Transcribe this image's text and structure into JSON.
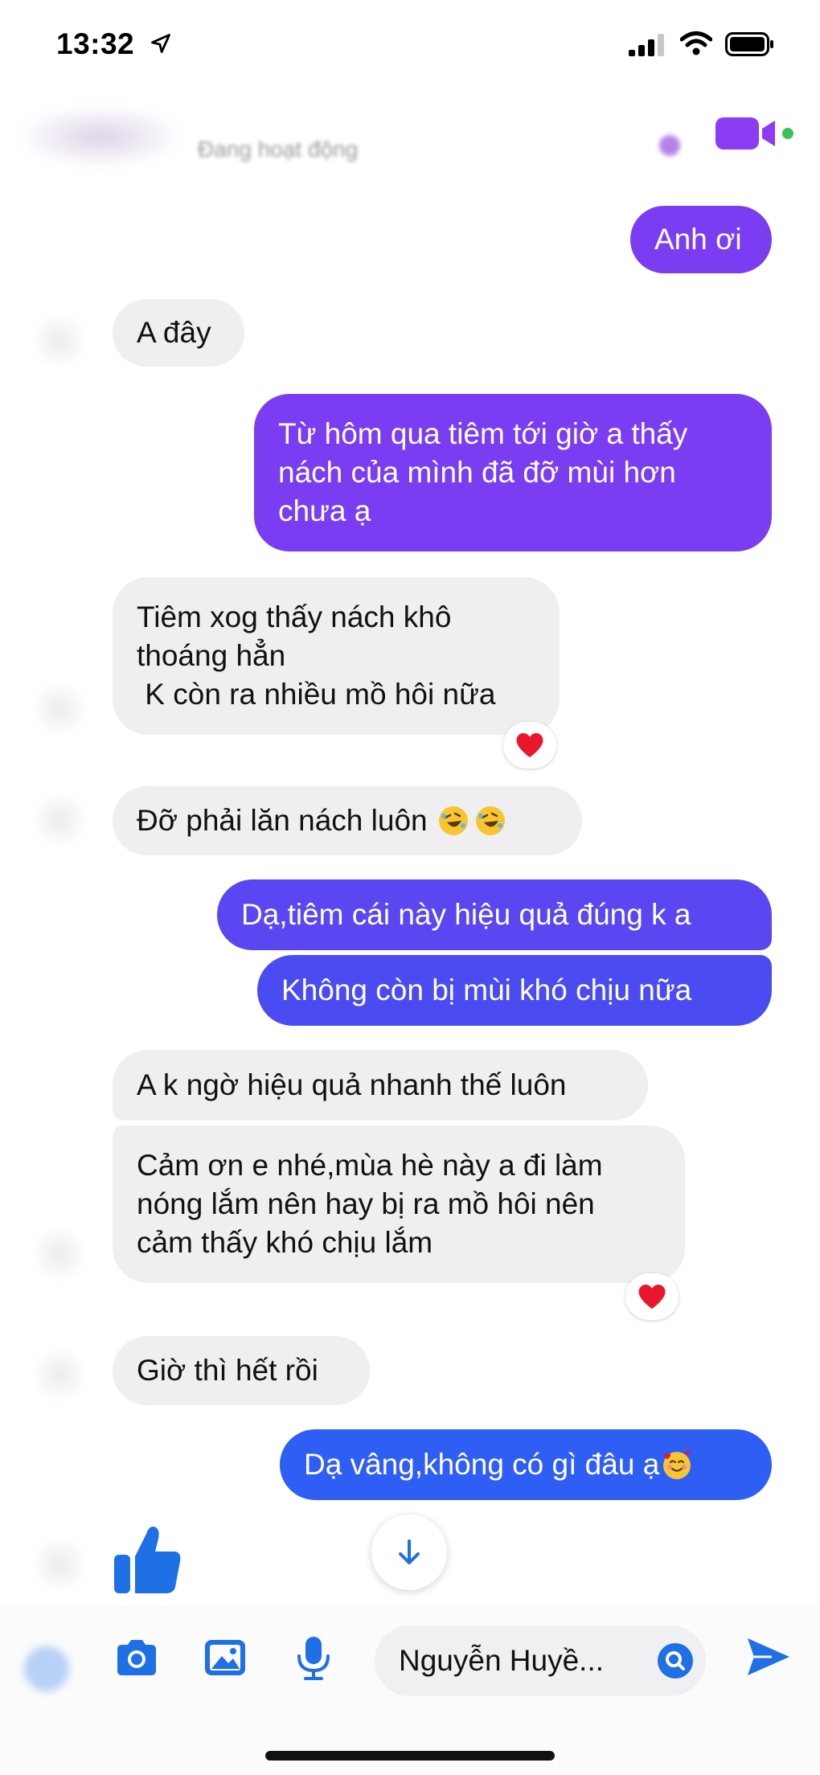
{
  "status_bar": {
    "time": "13:32"
  },
  "header": {
    "status_text": "Đang hoạt động"
  },
  "messages": {
    "m1": "Anh ơi",
    "m2": "A đây",
    "m3": [
      "Từ hôm qua tiêm tới giờ a thấy",
      "nách của mình đã đỡ mùi hơn",
      "chưa ạ"
    ],
    "m4": [
      "Tiêm xog thấy nách khô",
      "thoáng hẳn",
      " K còn ra nhiều mồ hôi nữa"
    ],
    "m5": "Đỡ phải lăn nách luôn",
    "m6": "Dạ,tiêm cái này hiệu quả đúng k a",
    "m7": "Không còn bị mùi khó chịu nữa",
    "m8": "A k ngờ hiệu quả nhanh thế luôn",
    "m9": [
      "Cảm ơn e nhé,mùa hè này a đi làm",
      "nóng lắm nên hay bị ra mồ hôi nên",
      "cảm thấy khó chịu lắm"
    ],
    "m10": "Giờ thì hết rồi",
    "m11": "Dạ vâng,không có gì đâu ạ"
  },
  "reactions": {
    "heart": "heart-reaction"
  },
  "composer": {
    "field_value": "Nguyễn Huyề..."
  },
  "colors": {
    "purple": "#7a3df2",
    "indigo": "#5a47f2",
    "blue": "#2f5ef4",
    "incoming": "#efeff1",
    "accent_icon": "#1f6fe5"
  }
}
